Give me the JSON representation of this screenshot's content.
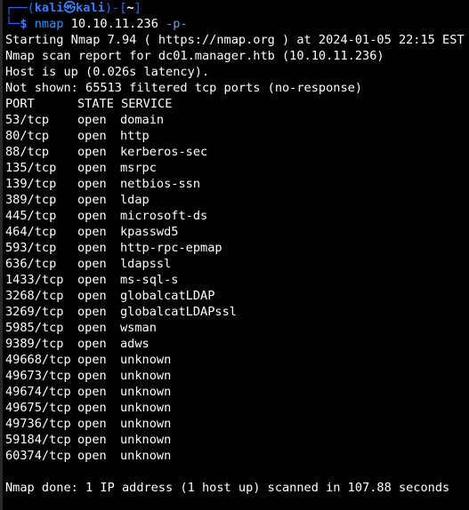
{
  "prompt": {
    "box_top": "┌──",
    "open_paren": "(",
    "user": "kali",
    "at_symbol": "㉿",
    "host": "kali",
    "close_paren": ")",
    "dash": "-",
    "dir_open": "[",
    "cwd": "~",
    "dir_close": "]",
    "box_bottom": "└─",
    "dollar": "$",
    "command": "nmap",
    "target": "10.10.11.236",
    "flag": "-p-"
  },
  "output": {
    "starting": "Starting Nmap 7.94 ( https://nmap.org ) at 2024-01-05 22:15 EST",
    "scan_report": "Nmap scan report for dc01.manager.htb (10.10.11.236)",
    "host_up": "Host is up (0.026s latency).",
    "not_shown": "Not shown: 65513 filtered tcp ports (no-response)",
    "header": {
      "port": "PORT",
      "state": "STATE",
      "service": "SERVICE"
    },
    "ports": [
      {
        "port": "53/tcp",
        "state": "open",
        "service": "domain"
      },
      {
        "port": "80/tcp",
        "state": "open",
        "service": "http"
      },
      {
        "port": "88/tcp",
        "state": "open",
        "service": "kerberos-sec"
      },
      {
        "port": "135/tcp",
        "state": "open",
        "service": "msrpc"
      },
      {
        "port": "139/tcp",
        "state": "open",
        "service": "netbios-ssn"
      },
      {
        "port": "389/tcp",
        "state": "open",
        "service": "ldap"
      },
      {
        "port": "445/tcp",
        "state": "open",
        "service": "microsoft-ds"
      },
      {
        "port": "464/tcp",
        "state": "open",
        "service": "kpasswd5"
      },
      {
        "port": "593/tcp",
        "state": "open",
        "service": "http-rpc-epmap"
      },
      {
        "port": "636/tcp",
        "state": "open",
        "service": "ldapssl"
      },
      {
        "port": "1433/tcp",
        "state": "open",
        "service": "ms-sql-s"
      },
      {
        "port": "3268/tcp",
        "state": "open",
        "service": "globalcatLDAP"
      },
      {
        "port": "3269/tcp",
        "state": "open",
        "service": "globalcatLDAPssl"
      },
      {
        "port": "5985/tcp",
        "state": "open",
        "service": "wsman"
      },
      {
        "port": "9389/tcp",
        "state": "open",
        "service": "adws"
      },
      {
        "port": "49668/tcp",
        "state": "open",
        "service": "unknown"
      },
      {
        "port": "49673/tcp",
        "state": "open",
        "service": "unknown"
      },
      {
        "port": "49674/tcp",
        "state": "open",
        "service": "unknown"
      },
      {
        "port": "49675/tcp",
        "state": "open",
        "service": "unknown"
      },
      {
        "port": "49736/tcp",
        "state": "open",
        "service": "unknown"
      },
      {
        "port": "59184/tcp",
        "state": "open",
        "service": "unknown"
      },
      {
        "port": "60374/tcp",
        "state": "open",
        "service": "unknown"
      }
    ],
    "done": "Nmap done: 1 IP address (1 host up) scanned in 107.88 seconds"
  },
  "colors": {
    "background": "#000000",
    "prompt_blue": "#3b7bf6",
    "text": "#ffffff"
  }
}
